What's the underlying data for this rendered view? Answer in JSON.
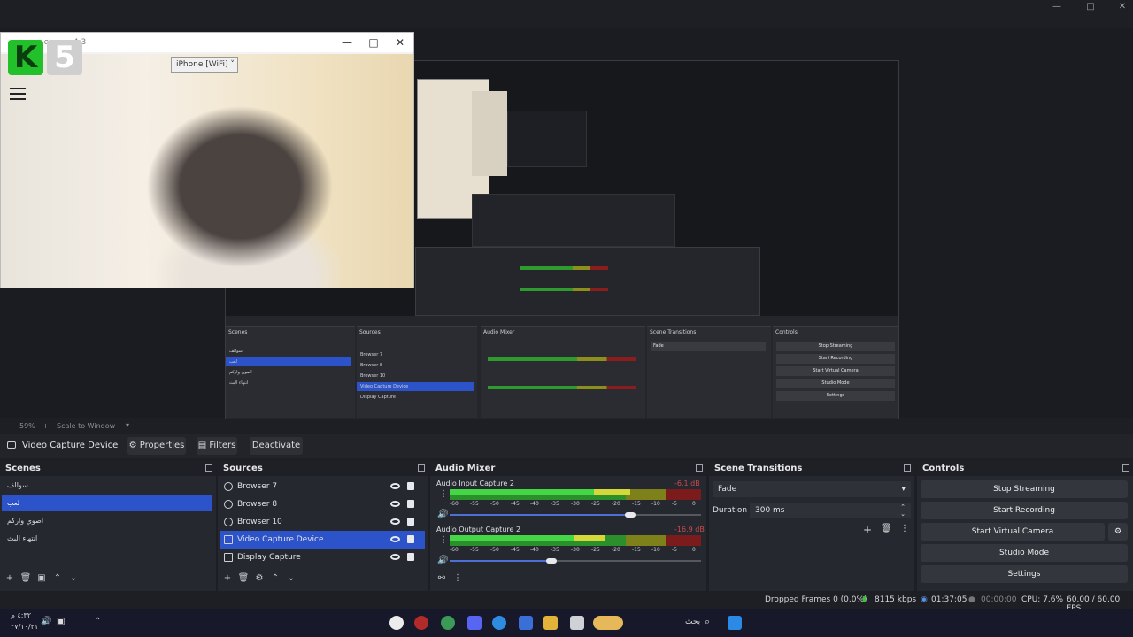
{
  "webcam": {
    "title": "...ebcam 4.3",
    "device": "iPhone [WiFi]",
    "logo_k": "K",
    "logo_num": "5"
  },
  "zoom": {
    "percent": "59%",
    "mode": "Scale to Window"
  },
  "context": {
    "source_name": "Video Capture Device",
    "properties": "Properties",
    "filters": "Filters",
    "deactivate": "Deactivate"
  },
  "scenes": {
    "title": "Scenes",
    "items": [
      "سوالف",
      "لعب",
      "اصوي واركم",
      "انتهاء البث"
    ],
    "selected_index": 1
  },
  "sources": {
    "title": "Sources",
    "items": [
      {
        "name": "Browser 7",
        "icon": "globe-icon"
      },
      {
        "name": "Browser 8",
        "icon": "globe-icon"
      },
      {
        "name": "Browser 10",
        "icon": "globe-icon"
      },
      {
        "name": "Video Capture Device",
        "icon": "camera-icon"
      },
      {
        "name": "Display Capture",
        "icon": "monitor-icon"
      }
    ],
    "selected_index": 3
  },
  "mixer": {
    "title": "Audio Mixer",
    "channels": [
      {
        "name": "Audio Input Capture 2",
        "db": "-6.1 dB",
        "level": 0.72,
        "volume": 0.92
      },
      {
        "name": "Audio Output Capture 2",
        "db": "-16.9 dB",
        "level": 0.62,
        "volume": 0.52
      }
    ],
    "scale": [
      "-60",
      "-55",
      "-50",
      "-45",
      "-40",
      "-35",
      "-30",
      "-25",
      "-20",
      "-15",
      "-10",
      "-5",
      "0"
    ]
  },
  "transitions": {
    "title": "Scene Transitions",
    "selected": "Fade",
    "duration_label": "Duration",
    "duration_value": "300 ms"
  },
  "controls": {
    "title": "Controls",
    "stop_streaming": "Stop Streaming",
    "start_recording": "Start Recording",
    "start_virtual_camera": "Start Virtual Camera",
    "studio_mode": "Studio Mode",
    "settings": "Settings"
  },
  "status": {
    "dropped_frames": "Dropped Frames 0 (0.0%)",
    "bitrate": "8115 kbps",
    "stream_time": "01:37:05",
    "rec_time": "00:00:00",
    "cpu": "CPU: 7.6%",
    "fps": "60.00 / 60.00 FPS"
  },
  "taskbar": {
    "time": "٤:٣٢ م",
    "date": "٢٧/١٠/٢١",
    "search": "بحث"
  },
  "colors": {
    "accent": "#2c53c9",
    "meter_green": "#2b8f2b",
    "meter_yellow": "#7e811a",
    "meter_red": "#7b1b1b"
  }
}
